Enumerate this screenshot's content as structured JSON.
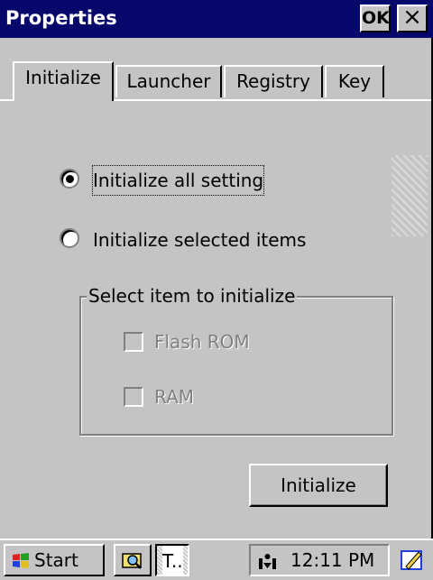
{
  "window": {
    "title": "Properties",
    "ok_label": "OK",
    "close_label": "×"
  },
  "tabs": [
    {
      "label": "Initialize",
      "active": true
    },
    {
      "label": "Launcher",
      "active": false
    },
    {
      "label": "Registry",
      "active": false
    },
    {
      "label": "Key",
      "active": false
    }
  ],
  "options": {
    "all": {
      "label": "Initialize all setting",
      "selected": true
    },
    "selected": {
      "label": "Initialize selected items",
      "selected": false
    }
  },
  "group": {
    "title": "Select item to initialize",
    "items": [
      {
        "label": "Flash ROM",
        "checked": false,
        "enabled": false
      },
      {
        "label": "RAM",
        "checked": false,
        "enabled": false
      }
    ]
  },
  "initialize_button": "Initialize",
  "taskbar": {
    "start_label": "Start",
    "task_label": "T..",
    "clock": "12:11 PM"
  },
  "colors": {
    "titlebar": "#06086c",
    "face": "#c6c3c6"
  }
}
